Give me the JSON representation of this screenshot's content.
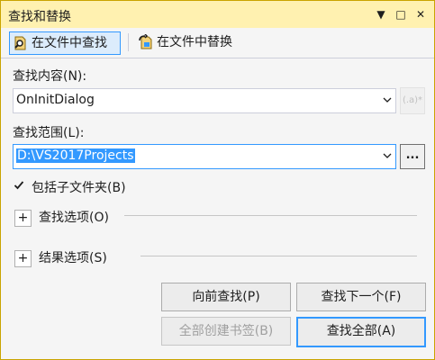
{
  "window": {
    "title": "查找和替换"
  },
  "titlebar_buttons": {
    "dropdown": "▼",
    "maximize": "□",
    "close": "✕"
  },
  "tabs": [
    {
      "label": "在文件中查找",
      "active": true,
      "icon": "find-in-files-icon"
    },
    {
      "label": "在文件中替换",
      "active": false,
      "icon": "replace-in-files-icon"
    }
  ],
  "find": {
    "label": "查找内容(N):",
    "value": "OnInitDialog",
    "regex_button": "(.a)*"
  },
  "scope": {
    "label": "查找范围(L):",
    "value": "D:\\VS2017Projects",
    "browse_label": "..."
  },
  "include_subfolders": {
    "label": "包括子文件夹(B)",
    "checked": true
  },
  "find_options": {
    "label": "查找选项(O)",
    "expander": "+"
  },
  "result_options": {
    "label": "结果选项(S)",
    "expander": "+"
  },
  "buttons": {
    "find_previous": "向前查找(P)",
    "find_next": "查找下一个(F)",
    "bookmark_all": "全部创建书签(B)",
    "find_all": "查找全部(A)"
  },
  "colors": {
    "accent": "#3399ff",
    "titlebar": "#fff1b0",
    "border": "#c9a400"
  }
}
